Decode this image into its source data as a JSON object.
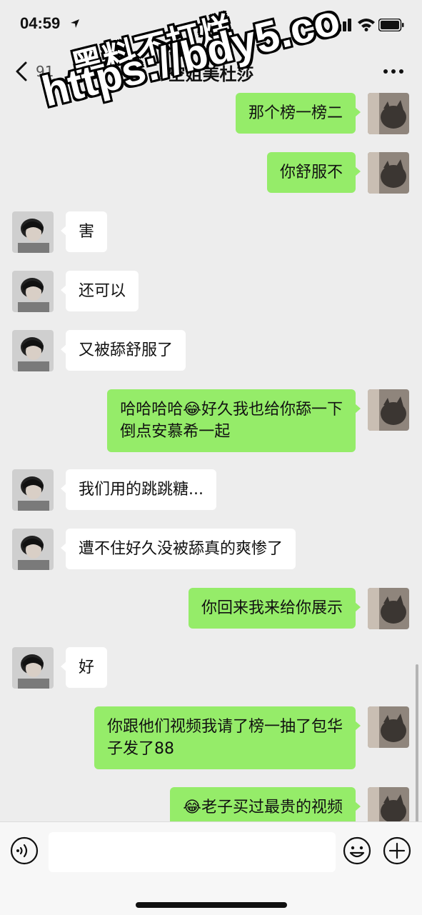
{
  "status_bar": {
    "time": "04:59"
  },
  "nav": {
    "unread_count": "91",
    "title": "空姐美杜莎"
  },
  "messages": [
    {
      "side": "right",
      "text": "那个榜一榜二"
    },
    {
      "side": "right",
      "text": "你舒服不"
    },
    {
      "side": "left",
      "text": "害"
    },
    {
      "side": "left",
      "text": "还可以"
    },
    {
      "side": "left",
      "text": "又被舔舒服了"
    },
    {
      "side": "right",
      "text": "哈哈哈哈😂好久我也给你舔一下\n倒点安慕希一起"
    },
    {
      "side": "left",
      "text": "我们用的跳跳糖..."
    },
    {
      "side": "left",
      "text": "遭不住好久没被舔真的爽惨了"
    },
    {
      "side": "right",
      "text": "你回来我来给你展示"
    },
    {
      "side": "left",
      "text": "好"
    },
    {
      "side": "right",
      "text": "你跟他们视频我请了榜一抽了包华\n子发了88"
    },
    {
      "side": "right",
      "text": "😂老子买过最贵的视频"
    }
  ],
  "input_bar": {
    "placeholder": ""
  },
  "watermark": {
    "line1": "黑料不打烊",
    "line2": "https://bdy5.co"
  },
  "colors": {
    "background": "#ededed",
    "bubble_self": "#95ec69",
    "bubble_other": "#ffffff"
  },
  "icons": [
    "location-arrow-icon",
    "signal-icon",
    "wifi-icon",
    "battery-icon",
    "back-chevron-icon",
    "more-dots-icon",
    "voice-icon",
    "emoji-icon",
    "plus-icon"
  ]
}
